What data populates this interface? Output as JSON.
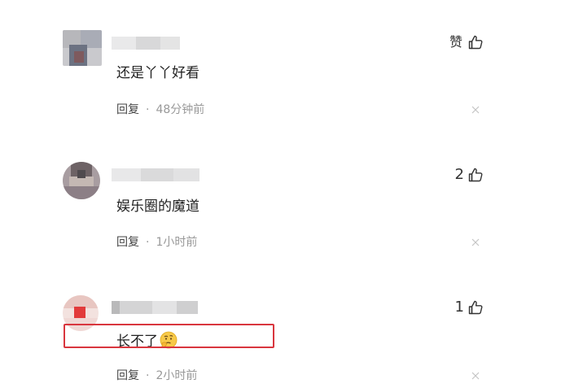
{
  "comments": [
    {
      "text": "还是丫丫好看",
      "like_label": "赞",
      "like_count": "",
      "reply_label": "回复",
      "separator": "·",
      "time": "48分钟前",
      "avatar_colors": [
        "#b7b7bb",
        "#8a8f9c",
        "#6c7282",
        "#9b8e8f",
        "#a99a98"
      ],
      "name_blur_colors": [
        "#e9e9ea",
        "#d8d8d9",
        "#e4e4e4"
      ]
    },
    {
      "text": "娱乐圈的魔道",
      "like_label": "",
      "like_count": "2",
      "reply_label": "回复",
      "separator": "·",
      "time": "1小时前",
      "avatar_colors": [
        "#a89da1",
        "#6d6265",
        "#8c7f86",
        "#c4b8b3",
        "#4f4a4e"
      ],
      "name_blur_colors": [
        "#e8e8e9",
        "#dadadb",
        "#e2e2e3"
      ]
    },
    {
      "text": "长不了",
      "emoji_icon": "thinking-face-emoji",
      "like_label": "",
      "like_count": "1",
      "reply_label": "回复",
      "separator": "·",
      "time": "2小时前",
      "avatar_colors": [
        "#f0d8d5",
        "#e8c6c1",
        "#e23b3b",
        "#f3e2df",
        "#d9b3ae"
      ],
      "name_blur_colors": [
        "#cfcfd0",
        "#e3e3e4",
        "#d4d4d5"
      ]
    }
  ],
  "icons": {
    "like": "thumbs-up-icon",
    "close": "close-icon",
    "emoji": "thinking-face-emoji"
  },
  "colors": {
    "highlight_border": "#d9363e",
    "muted_text": "#999999",
    "body_text": "#222222"
  }
}
